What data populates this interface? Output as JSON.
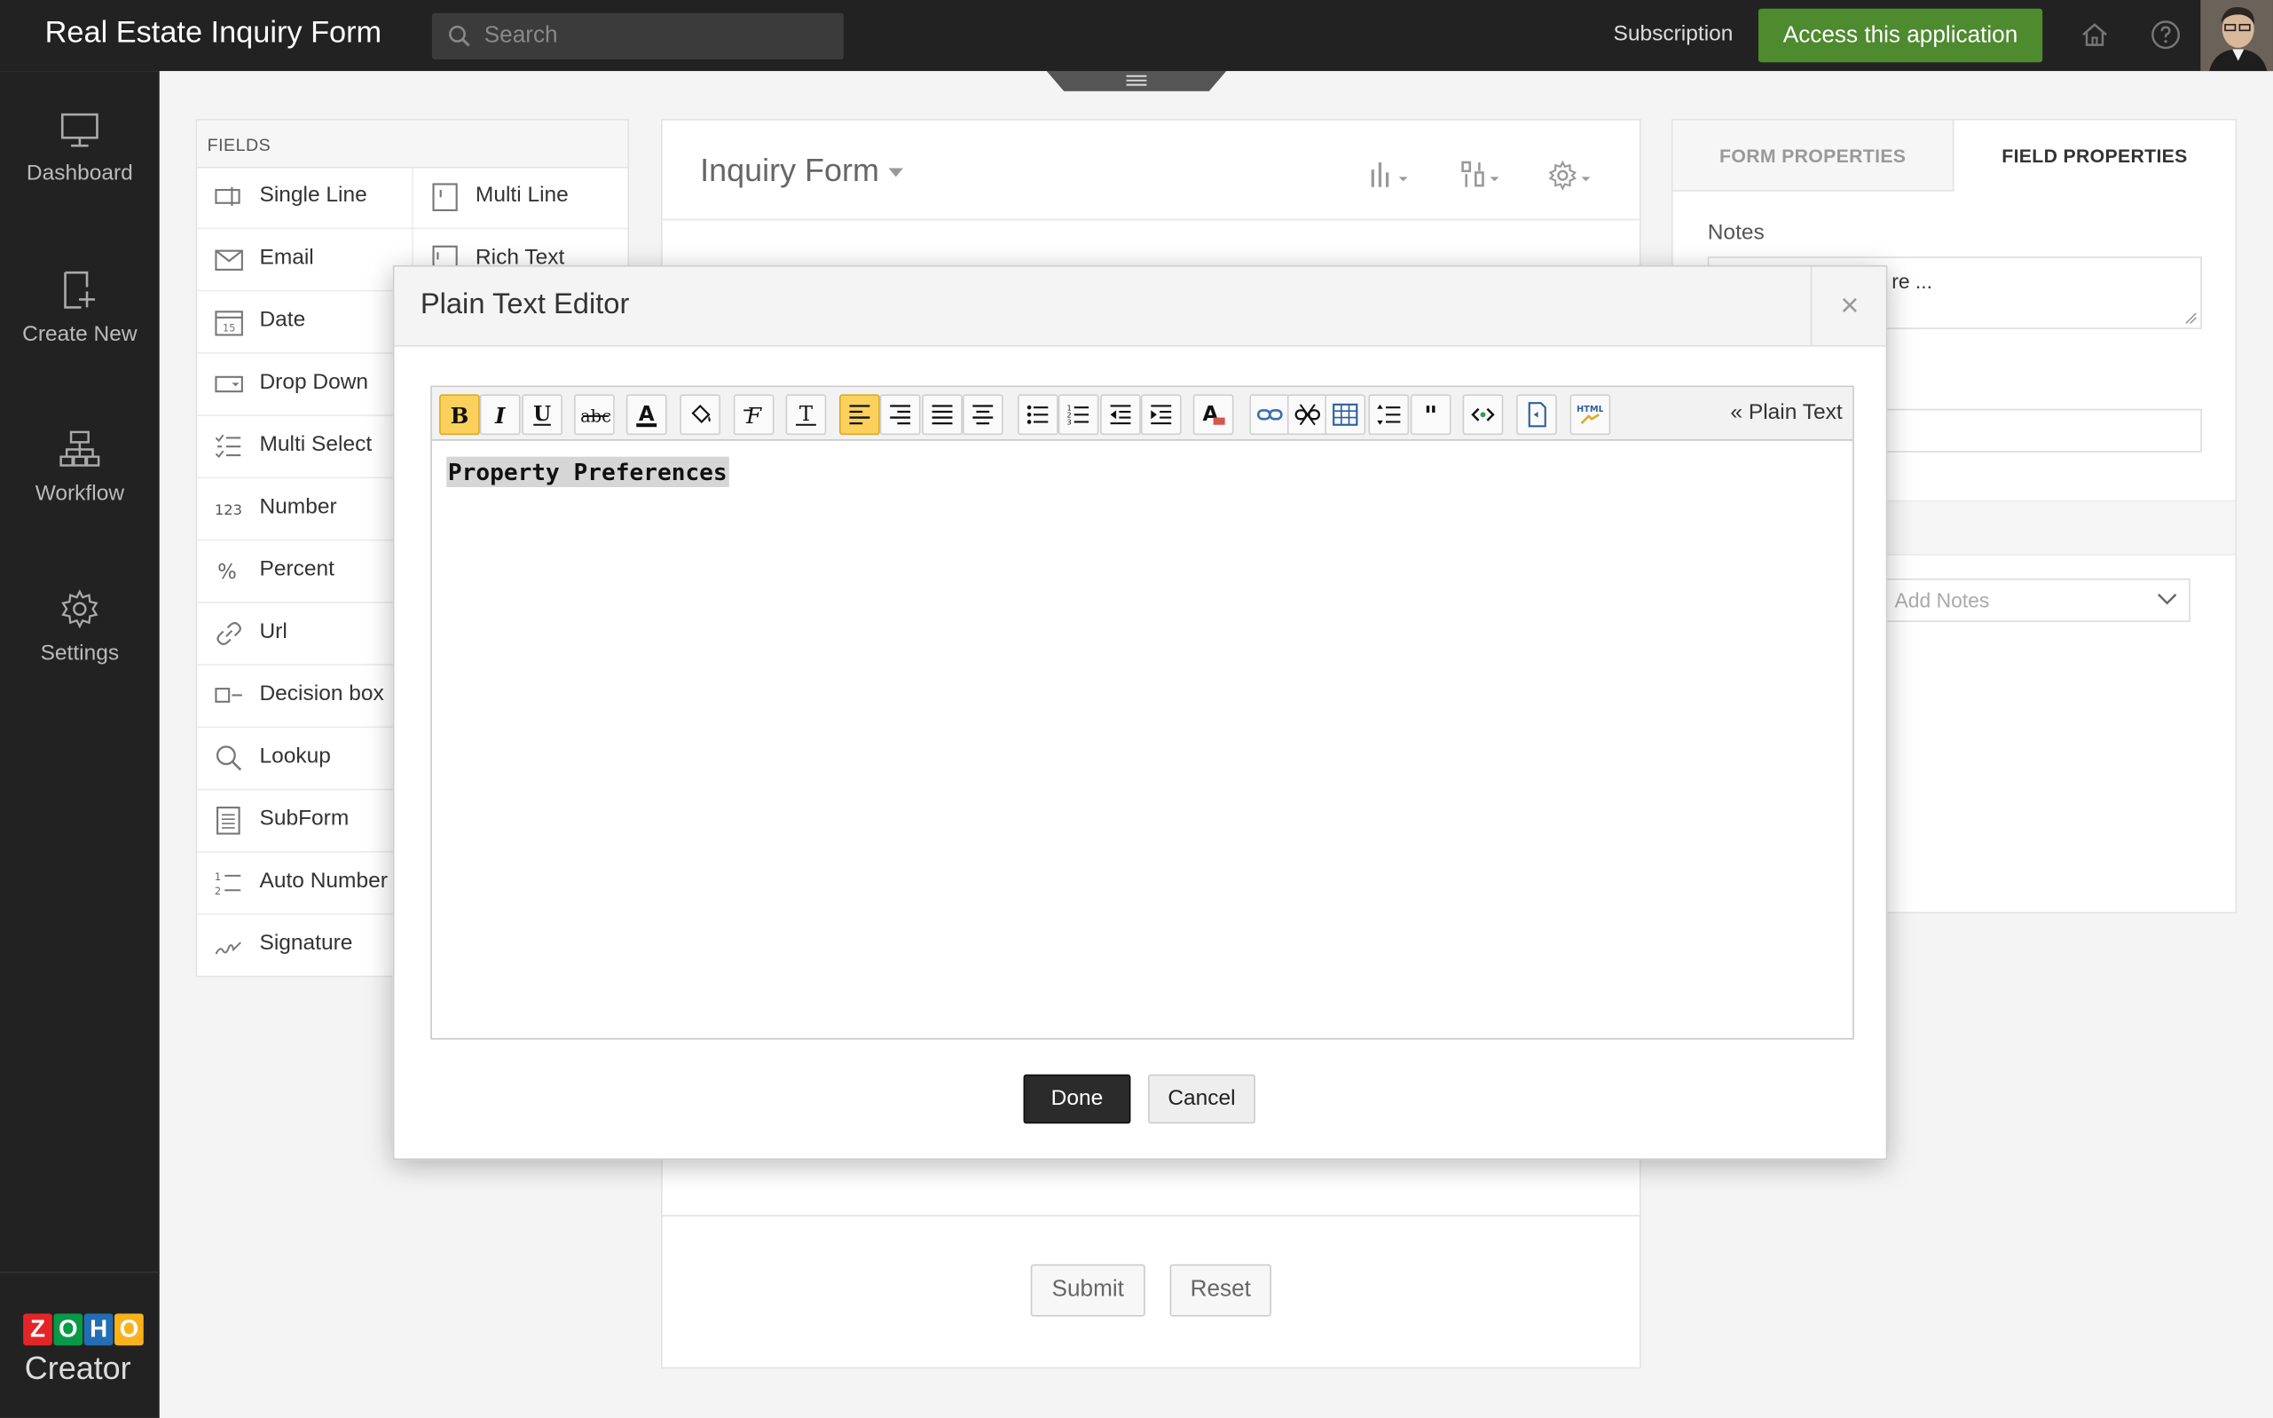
{
  "header": {
    "app_title": "Real Estate Inquiry Form",
    "search_placeholder": "Search",
    "subscription": "Subscription",
    "access_button": "Access this application"
  },
  "nav": {
    "items": [
      {
        "label": "Dashboard",
        "icon": "monitor-icon"
      },
      {
        "label": "Create New",
        "icon": "create-new-icon"
      },
      {
        "label": "Workflow",
        "icon": "workflow-icon"
      },
      {
        "label": "Settings",
        "icon": "gear-icon"
      }
    ],
    "brand_letters": [
      "Z",
      "O",
      "H",
      "O"
    ],
    "brand_colors": [
      "#e42527",
      "#089949",
      "#226db4",
      "#f9b21d"
    ],
    "brand_product": "Creator"
  },
  "fields": {
    "title": "FIELDS",
    "left": [
      "Single Line",
      "Email",
      "Date",
      "Drop Down",
      "Multi Select",
      "Number",
      "Percent",
      "Url",
      "Decision box",
      "Lookup",
      "SubForm",
      "Auto Number",
      "Signature"
    ],
    "right": [
      "Multi Line",
      "Rich Text"
    ]
  },
  "form": {
    "title": "Inquiry Form",
    "submit": "Submit",
    "reset": "Reset"
  },
  "properties": {
    "tab_form": "FORM PROPERTIES",
    "tab_field": "FIELD PROPERTIES",
    "notes_label": "Notes",
    "notes_value": "re ...",
    "select_placeholder": "Add Notes"
  },
  "modal": {
    "title": "Plain Text Editor",
    "close": "×",
    "plain_text_link": "« Plain Text",
    "content": "Property Preferences",
    "done": "Done",
    "cancel": "Cancel"
  },
  "colors": {
    "accent_green": "#4e8a2e",
    "topbar": "#222222",
    "active_toolbar": "#fbd15c"
  }
}
